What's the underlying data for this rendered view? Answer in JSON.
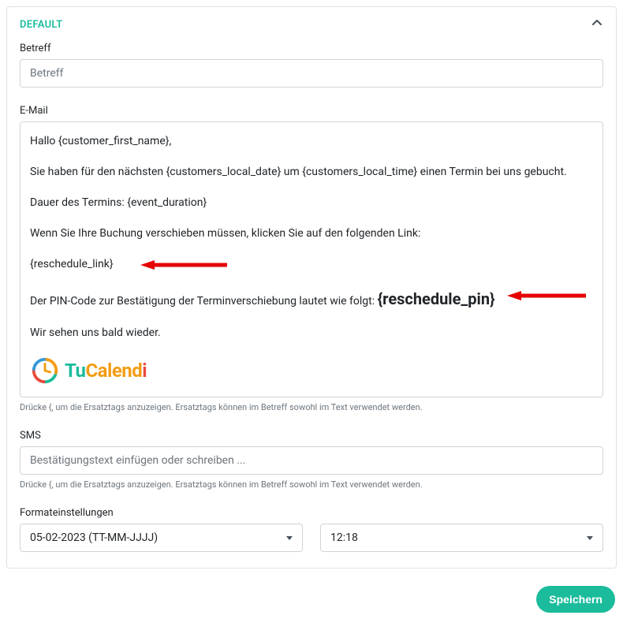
{
  "panel": {
    "title": "DEFAULT"
  },
  "subject": {
    "label": "Betreff",
    "placeholder": "Betreff"
  },
  "email": {
    "label": "E-Mail",
    "lines": {
      "l1": "Hallo {customer_first_name},",
      "l2": "Sie haben für den nächsten {customers_local_date} um {customers_local_time} einen Termin bei uns gebucht.",
      "l3": "Dauer des Termins: {event_duration}",
      "l4": "Wenn Sie Ihre Buchung verschieben müssen, klicken Sie auf den folgenden Link:",
      "l5": "{reschedule_link}",
      "l6a": "Der PIN-Code zur Bestätigung der Terminverschiebung lautet wie folgt: ",
      "l6b": "{reschedule_pin}",
      "l7": "Wir sehen uns bald wieder."
    },
    "helper": "Drücke {, um die Ersatztags anzuzeigen. Ersatztags können im Betreff sowohl im Text verwendet werden."
  },
  "sms": {
    "label": "SMS",
    "placeholder": "Bestätigungstext einfügen oder schreiben ...",
    "helper": "Drücke {, um die Ersatztags anzuzeigen. Ersatztags können im Betreff sowohl im Text verwendet werden."
  },
  "format": {
    "label": "Formateinstellungen",
    "date": "05-02-2023 (TT-MM-JJJJ)",
    "time": "12:18"
  },
  "save": {
    "label": "Speichern"
  },
  "logo": {
    "text1": "Tu",
    "text2": "Calend",
    "text3": "i"
  }
}
